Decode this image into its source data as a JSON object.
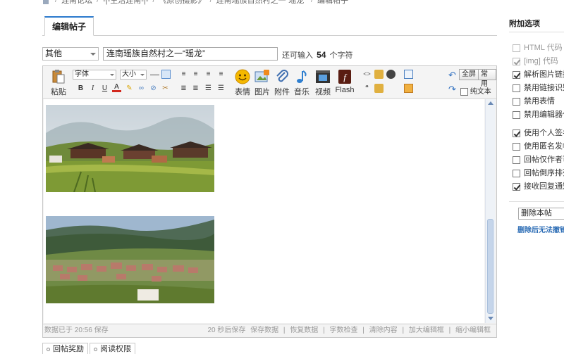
{
  "breadcrumb": [
    "连南论坛",
    "-|-生活连南-|-",
    "《原创摄影》",
    "连南瑶族自然村之一“瑶龙”",
    "编辑帖子"
  ],
  "tab": {
    "label": "编辑帖子"
  },
  "subject": {
    "type_value": "其他",
    "title_value": "连南瑶族自然村之一“瑶龙”",
    "remain_prefix": "还可输入",
    "remain_count": "54",
    "remain_suffix": "个字符"
  },
  "toolbar": {
    "paste": "粘贴",
    "font": "字体",
    "size": "大小",
    "bold": "B",
    "italic": "I",
    "underline": "U",
    "fontcolor": "A",
    "emoticon": "表情",
    "image": "图片",
    "attach": "附件",
    "music": "音乐",
    "video": "视频",
    "flash": "Flash",
    "fullscreen": "全屏",
    "common": "常用",
    "plaintext": "纯文本",
    "quote": "“"
  },
  "icons": {
    "paste": "paste-icon",
    "emoticon": "smiley-icon",
    "image": "image-icon",
    "attach": "paperclip-icon",
    "music": "music-note-icon",
    "video": "film-icon",
    "flash": "flash-icon",
    "undo": "undo-icon",
    "redo": "redo-icon"
  },
  "status": {
    "saved": "数据已于 20:56 保存",
    "autosave": "20 秒后保存",
    "links": [
      "保存数据",
      "恢复数据",
      "字数检查",
      "清除内容",
      "加大编辑框",
      "缩小编辑框"
    ]
  },
  "bottom_tabs": [
    "回帖奖励",
    "阅读权限"
  ],
  "options": {
    "title": "附加选项",
    "items": [
      {
        "label": "HTML 代码",
        "checked": false,
        "disabled": true
      },
      {
        "label": "[img] 代码",
        "checked": true,
        "disabled": true
      },
      {
        "label": "解析图片链接",
        "checked": true,
        "disabled": false
      },
      {
        "label": "禁用链接识别",
        "checked": false,
        "disabled": false
      },
      {
        "label": "禁用表情",
        "checked": false,
        "disabled": false
      },
      {
        "label": "禁用编辑器代",
        "checked": false,
        "disabled": false
      },
      {
        "label": "使用个人签名",
        "checked": true,
        "disabled": false
      },
      {
        "label": "使用匿名发帖",
        "checked": false,
        "disabled": false
      },
      {
        "label": "回帖仅作者可",
        "checked": false,
        "disabled": false
      },
      {
        "label": "回帖倒序排列",
        "checked": false,
        "disabled": false
      },
      {
        "label": "接收回复通知",
        "checked": true,
        "disabled": false
      }
    ],
    "delete_select": "删除本帖",
    "delete_warning": "删除后无法撤销"
  },
  "colors": {
    "accent": "#2b7acd",
    "link": "#2b6cb5",
    "status": "#999999"
  }
}
